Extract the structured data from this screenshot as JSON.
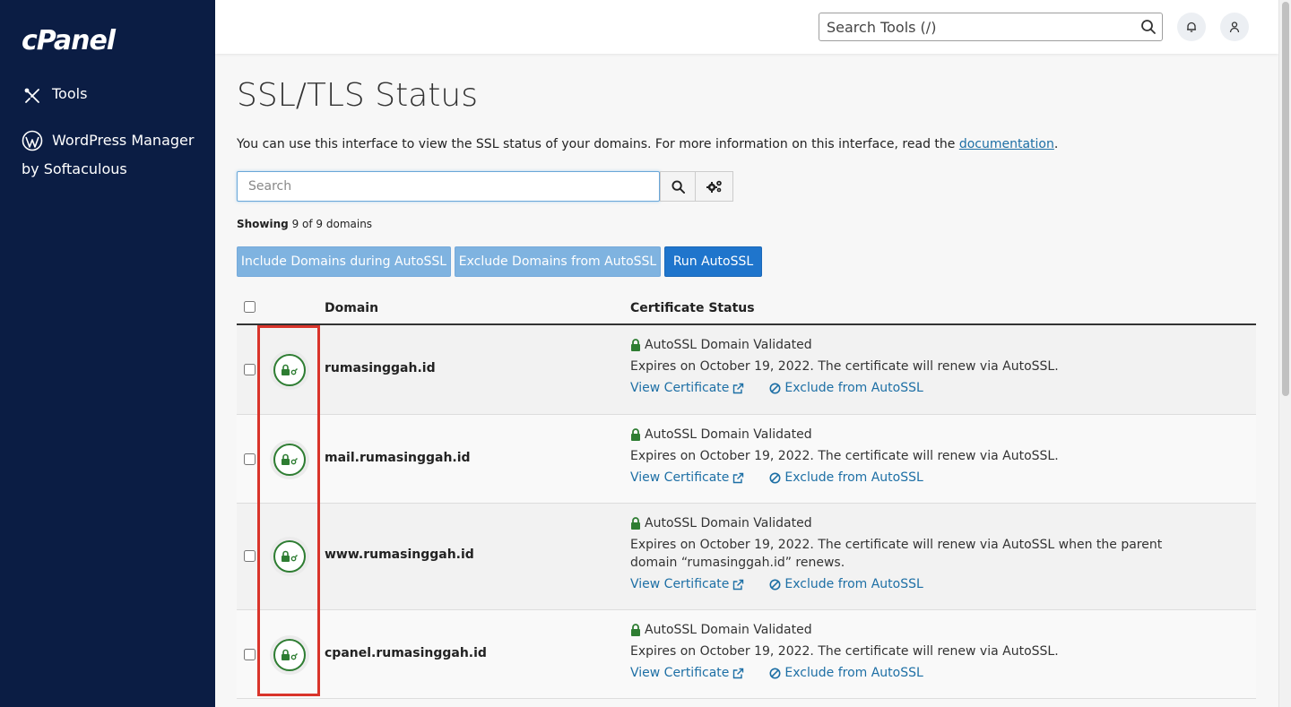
{
  "sidebar": {
    "logo": "cPanel",
    "items": [
      {
        "label": "Tools",
        "icon": "tools-icon"
      },
      {
        "label": "WordPress Manager by Softaculous",
        "icon": "wordpress-icon"
      }
    ]
  },
  "header": {
    "search_placeholder": "Search Tools (/)"
  },
  "page": {
    "title": "SSL/TLS Status",
    "intro_text": "You can use this interface to view the SSL status of your domains. For more information on this interface, read the ",
    "intro_link": "documentation",
    "intro_end": ".",
    "search_placeholder": "Search",
    "showing_label": "Showing",
    "showing_text": " 9 of 9 domains"
  },
  "actions": {
    "include": "Include Domains during AutoSSL",
    "exclude": "Exclude Domains from AutoSSL",
    "run": "Run AutoSSL"
  },
  "table": {
    "col_domain": "Domain",
    "col_status": "Certificate Status",
    "view_cert": "View Certificate",
    "exclude_link": "Exclude from AutoSSL",
    "rows": [
      {
        "domain": "rumasinggah.id",
        "validated": "AutoSSL Domain Validated",
        "expires": "Expires on October 19, 2022. The certificate will renew via AutoSSL."
      },
      {
        "domain": "mail.rumasinggah.id",
        "validated": "AutoSSL Domain Validated",
        "expires": "Expires on October 19, 2022. The certificate will renew via AutoSSL."
      },
      {
        "domain": "www.rumasinggah.id",
        "validated": "AutoSSL Domain Validated",
        "expires": "Expires on October 19, 2022. The certificate will renew via AutoSSL when the parent domain “rumasinggah.id” renews."
      },
      {
        "domain": "cpanel.rumasinggah.id",
        "validated": "AutoSSL Domain Validated",
        "expires": "Expires on October 19, 2022. The certificate will renew via AutoSSL."
      }
    ]
  },
  "colors": {
    "sidebar_bg": "#0b1d44",
    "accent": "#1f75cc",
    "accent_light": "#7fb3e0",
    "link": "#1d6fa5",
    "valid_green": "#2e7d32",
    "highlight_red": "#d9342b"
  }
}
